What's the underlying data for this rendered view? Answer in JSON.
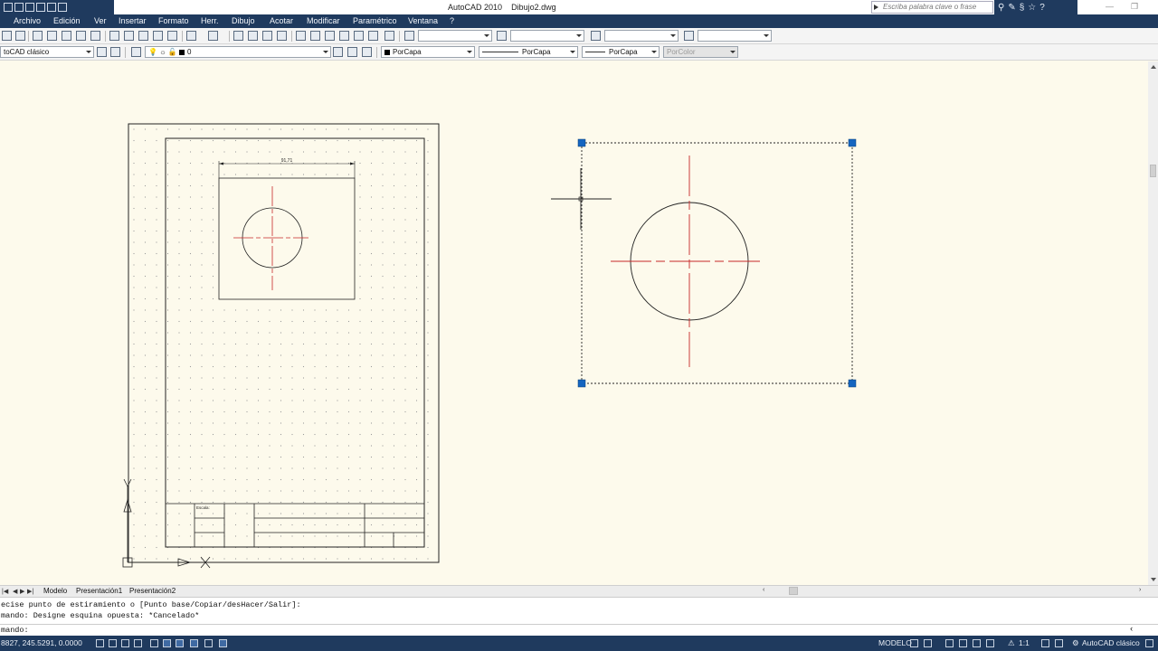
{
  "titlebar": {
    "app_name": "AutoCAD 2010",
    "file_name": "Dibujo2.dwg",
    "search_placeholder": "Escriba palabra clave o frase"
  },
  "menu": [
    "Archivo",
    "Edición",
    "Ver",
    "Insertar",
    "Formato",
    "Herr.",
    "Dibujo",
    "Acotar",
    "Modificar",
    "Paramétrico",
    "Ventana",
    "?"
  ],
  "toolbar2": {
    "workspace": "toCAD clásico",
    "layer": "0",
    "color": "PorCapa",
    "linetype": "PorCapa",
    "lineweight": "PorCapa",
    "plotstyle": "PorColor"
  },
  "drawing": {
    "dimension_value": "91,71",
    "titleblock_label": "Escala:",
    "colors": {
      "background": "#fdfaec",
      "centerline": "#c62828",
      "grip": "#1565c0",
      "geometry": "#222222"
    }
  },
  "tabs": [
    "Modelo",
    "Presentación1",
    "Presentación2"
  ],
  "command": {
    "history": [
      "ecise punto de estiramiento o [Punto base/Copiar/desHacer/Salir]:",
      "mando: Designe esquina opuesta: *Cancelado*"
    ],
    "prompt": "mando:"
  },
  "status": {
    "coordinates": "8827, 245.5291, 0.0000",
    "space": "MODELO",
    "scale": "1:1",
    "workspace": "AutoCAD clásico"
  }
}
